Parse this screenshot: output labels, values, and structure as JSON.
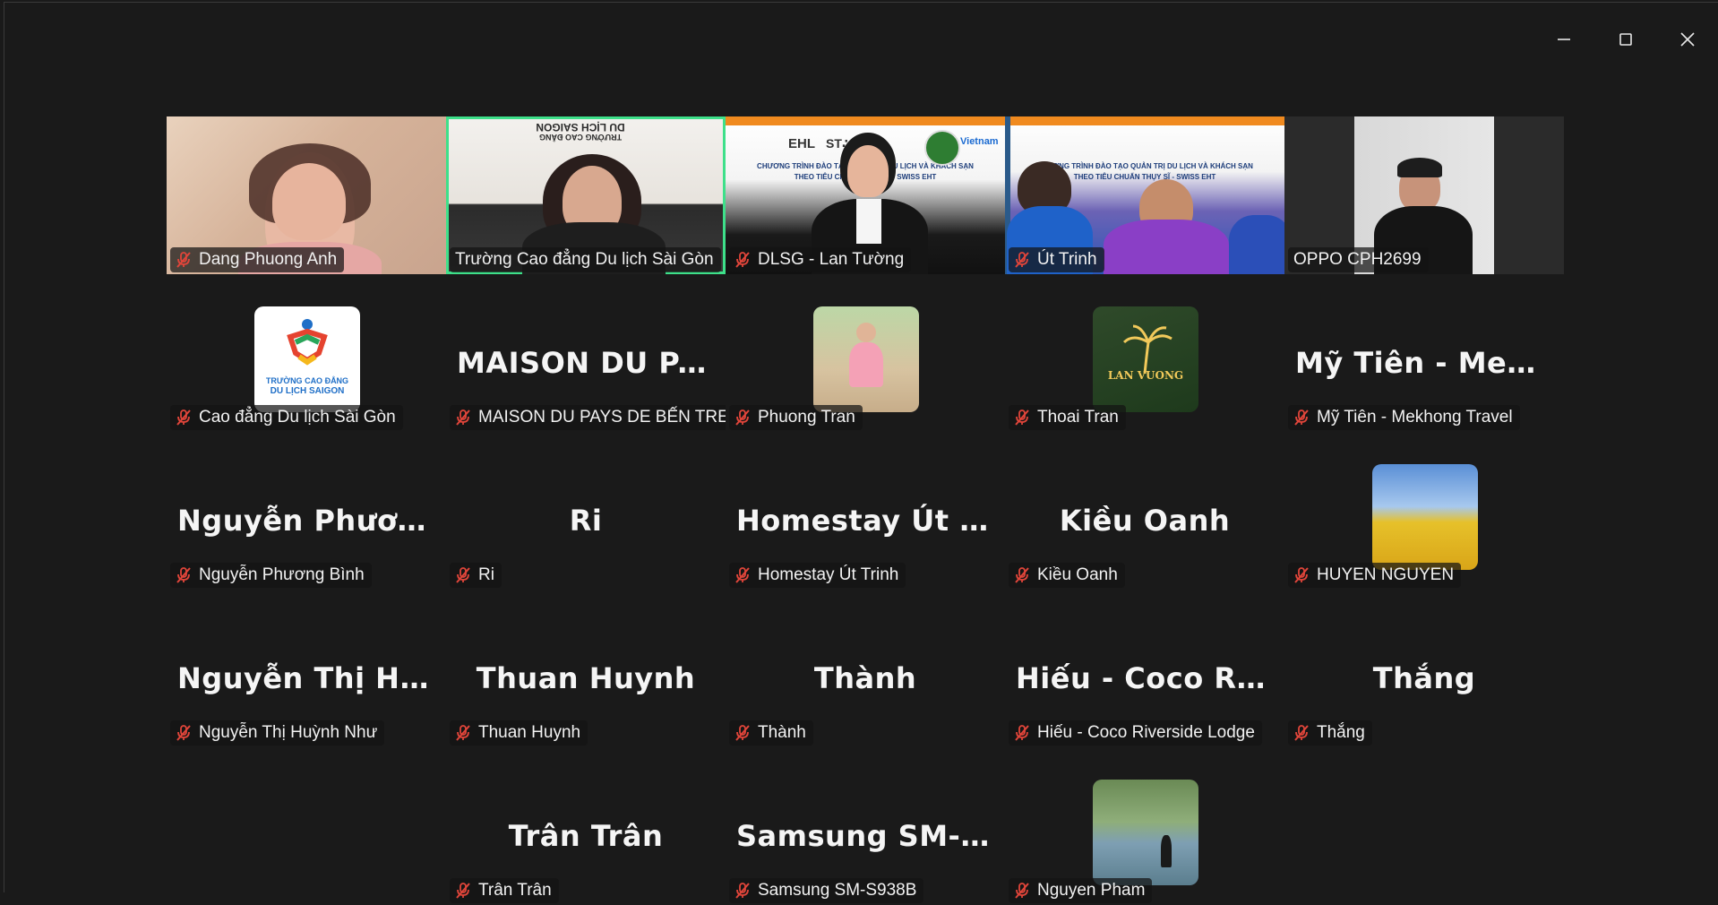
{
  "window": {
    "controls": [
      "minimize-icon",
      "maximize-icon",
      "close-icon"
    ]
  },
  "video_row": [
    {
      "name": "Dang Phuong Anh",
      "muted": true,
      "active": false
    },
    {
      "name": "Trường Cao đẳng Du lịch Sài Gòn",
      "muted": false,
      "active": true
    },
    {
      "name": "DLSG - Lan Tường",
      "muted": true,
      "active": false
    },
    {
      "name": "Út Trinh",
      "muted": true,
      "active": false
    },
    {
      "name": "OPPO CPH2699",
      "muted": false,
      "active": false
    }
  ],
  "video_overlay_text": {
    "slide_logo_text": "EHL",
    "slide_logo_text_2": "ST∴SD",
    "slide_vietnam": "Vietnam",
    "slide_title_1": "CHƯƠNG TRÌNH ĐÀO TẠO QUẢN TRỊ DU LỊCH VÀ KHÁCH SẠN",
    "slide_title_2": "THEO TIÊU CHUẨN THỤY SĨ - SWISS EHT",
    "banner_line1": "TRƯỜNG CAO ĐẲNG",
    "banner_line2": "DU LỊCH SAIGON"
  },
  "participants": [
    {
      "big": "",
      "label": "Cao đẳng Du lịch Sài Gòn",
      "avatar": "logo",
      "logo_line1": "TRƯỜNG CAO ĐẲNG",
      "logo_line2": "DU LỊCH SAIGON"
    },
    {
      "big": "MAISON DU PA...",
      "label": "MAISON DU PAYS DE BẾN TRE",
      "avatar": ""
    },
    {
      "big": "",
      "label": "Phuong Tran",
      "avatar": "swing"
    },
    {
      "big": "",
      "label": "Thoai Tran",
      "avatar": "lan",
      "logo_text": "LAN VUONG"
    },
    {
      "big": "Mỹ Tiên - Mekh...",
      "label": "Mỹ Tiên - Mekhong Travel",
      "avatar": ""
    },
    {
      "big": "Nguyễn Phươn...",
      "label": "Nguyễn Phương Bình",
      "avatar": ""
    },
    {
      "big": "Ri",
      "label": "Ri",
      "avatar": ""
    },
    {
      "big": "Homestay Út Tr...",
      "label": "Homestay Út Trinh",
      "avatar": ""
    },
    {
      "big": "Kiều Oanh",
      "label": "Kiều Oanh",
      "avatar": ""
    },
    {
      "big": "",
      "label": "HUYEN NGUYEN",
      "avatar": "sunflower"
    },
    {
      "big": "Nguyễn Thị Hu...",
      "label": "Nguyễn Thị Huỳnh Như",
      "avatar": ""
    },
    {
      "big": "Thuan Huynh",
      "label": "Thuan Huynh",
      "avatar": ""
    },
    {
      "big": "Thành",
      "label": "Thành",
      "avatar": ""
    },
    {
      "big": "Hiếu - Coco Riv...",
      "label": "Hiếu - Coco Riverside Lodge",
      "avatar": ""
    },
    {
      "big": "Thắng",
      "label": "Thắng",
      "avatar": ""
    },
    {
      "big": "Trân Trân",
      "label": "Trân Trân",
      "avatar": ""
    },
    {
      "big": "Samsung SM-S...",
      "label": "Samsung SM-S938B",
      "avatar": ""
    },
    {
      "big": "",
      "label": "Nguyen Pham",
      "avatar": "river"
    }
  ],
  "colors": {
    "background": "#1a1a1a",
    "active_border": "#3ee08a",
    "muted_icon": "#e0453a"
  }
}
